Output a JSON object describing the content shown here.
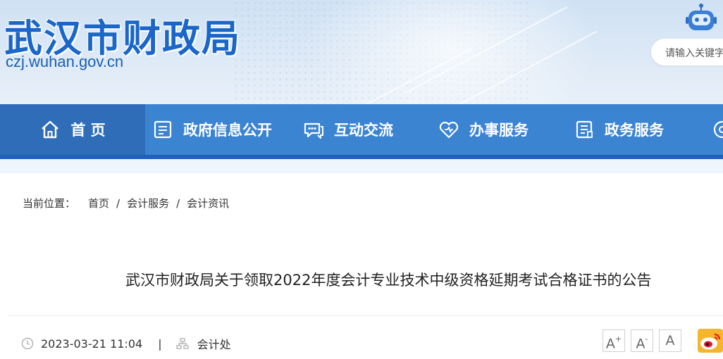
{
  "header": {
    "site_title": "武汉市财政局",
    "site_domain": "czj.wuhan.gov.cn",
    "search_placeholder": "请输入关键字"
  },
  "nav": {
    "items": [
      {
        "label": "首 页",
        "icon": "home-icon",
        "active": true
      },
      {
        "label": "政府信息公开",
        "icon": "document-icon"
      },
      {
        "label": "互动交流",
        "icon": "chat-icon"
      },
      {
        "label": "办事服务",
        "icon": "heart-icon"
      },
      {
        "label": "政务服务",
        "icon": "list-icon"
      }
    ]
  },
  "breadcrumb": {
    "label": "当前位置：",
    "items": [
      "首页",
      "会计服务",
      "会计资讯"
    ],
    "separator": "/"
  },
  "article": {
    "title": "武汉市财政局关于领取2022年度会计专业技术中级资格延期考试合格证书的公告",
    "date": "2023-03-21 11:04",
    "source": "会计处"
  },
  "font_size": {
    "increase": "A",
    "decrease": "A",
    "reset": "A"
  },
  "colors": {
    "brand_blue": "#1a66c9",
    "nav_blue": "#3b84d2",
    "nav_active": "#2f6db8"
  }
}
